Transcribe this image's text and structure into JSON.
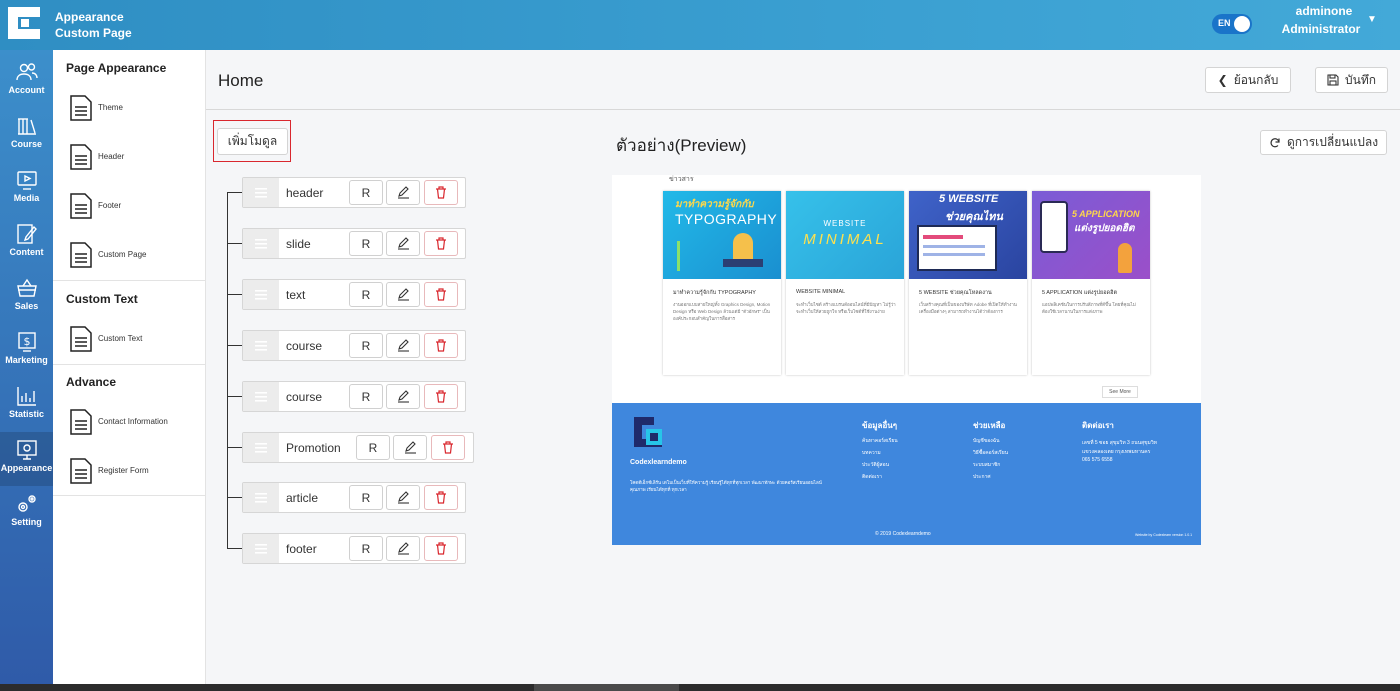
{
  "app": {
    "title_line1": "Appearance",
    "title_line2": "Custom Page"
  },
  "topbar": {
    "lang": "EN",
    "user_name": "adminone",
    "user_role": "Administrator"
  },
  "nav": [
    {
      "label": "Account",
      "icon": "users-icon"
    },
    {
      "label": "Course",
      "icon": "library-icon"
    },
    {
      "label": "Media",
      "icon": "media-icon"
    },
    {
      "label": "Content",
      "icon": "edit-icon"
    },
    {
      "label": "Sales",
      "icon": "basket-icon"
    },
    {
      "label": "Marketing",
      "icon": "dollar-icon"
    },
    {
      "label": "Statistic",
      "icon": "chart-icon"
    },
    {
      "label": "Appearance",
      "icon": "monitor-icon",
      "active": true
    },
    {
      "label": "Setting",
      "icon": "gears-icon"
    }
  ],
  "panel": {
    "page_appearance": {
      "title": "Page Appearance",
      "items": [
        "Theme",
        "Header",
        "Footer",
        "Custom Page"
      ]
    },
    "custom_text": {
      "title": "Custom Text",
      "items": [
        "Custom Text"
      ]
    },
    "advance": {
      "title": "Advance",
      "items": [
        "Contact Information",
        "Register Form"
      ]
    }
  },
  "main": {
    "title": "Home",
    "back_label": "ย้อนกลับ",
    "save_label": "บันทึก",
    "add_module_label": "เพิ่มโมดูล",
    "preview_title": "ตัวอย่าง(Preview)",
    "refresh_label": "ดูการเปลี่ยนแปลง",
    "r_label": "R",
    "modules": [
      "header",
      "slide",
      "text",
      "course",
      "course",
      "Promotion",
      "article",
      "footer"
    ]
  },
  "preview": {
    "section_label": "ข่าวสาร",
    "cards": [
      {
        "img_text_top": "มาทำความรู้จักกับ",
        "img_text_bottom": "TYPOGRAPHY",
        "title": "มาทำความรู้จักกับ TYPOGRAPHY",
        "text": "งานออกแบบสายใหญ่ทั้ง Graphics Design, Motion Design หรือ Web Design ล้วนแต่มี \"ตัวอักษร\" เป็นองค์ประกอบสำคัญในการสื่อสาร"
      },
      {
        "img_text_top": "WEBSITE",
        "img_text_bottom": "MINIMAL",
        "title": "WEBSITE MINIMAL",
        "text": "จะทำเว็บไซต์ สร้างแบรนด์ออนไลน์ที่มีปัญหา ไม่รู้ว่าจะทำเว็บให้สวยถูกใจ หรือเว็บไซต์ที่ใช้งานง่าย"
      },
      {
        "img_text_top": "5 WEBSITE",
        "img_text_bottom": "ช่วยคุณไทน",
        "title": "5 WEBSITE ช่วยคุณโหลดงาน",
        "text": "เว็บสร้างคุณที่เป็นของบริษัท Adobe ที่เปิดให้ทำงานเครื่องมือต่างๆ สามารถทำงานได้ว่าต้องการ"
      },
      {
        "img_text_top": "5 APPLICATION",
        "img_text_bottom": "แต่งรูปยอดฮิต",
        "title": "5 APPLICATION แต่งรูปยอดฮิต",
        "text": "แอปพลิเคชันในการปรับสีภาพที่ดีขึ้น โดยที่คุณไม่ต้องใช้เวลานานในการแต่งภาพ"
      }
    ],
    "see_more": "See More",
    "footer": {
      "brand": "Codexlearndemo",
      "desc": "โคดดีเอ็กซ์เลิร์น เดโมเป็นเว็บที่ให้ความรู้ เรียนรู้ได้ทุกที่ทุกเวลา พัฒนาทักษะ ด้วยคอร์สเรียนออนไลน์คุณภาพ เรียนได้ทุกที่ ทุกเวลา",
      "col1_title": "ข้อมูลอื่นๆ",
      "col1_links": [
        "ค้นหาคอร์สเรียน",
        "บทความ",
        "ประวัติผู้สอน",
        "ติดต่อเรา"
      ],
      "col2_title": "ช่วยเหลือ",
      "col2_links": [
        "บัญชีของฉัน",
        "วิธีซื้อคอร์สเรียน",
        "ระบบสมาชิก",
        "ประกาศ"
      ],
      "col3_title": "ติดต่อเรา",
      "col3_lines": [
        "เลขที่ 5 ซอย สุขุมวิท 3 ถนนสุขุมวิท",
        "แขวงคลองเตย กรุงเทพมหานคร",
        "065 575 6558"
      ],
      "copyright": "© 2019 Codexlearndemo",
      "credit": "Website by Codexlearn version 1.0.1"
    }
  }
}
